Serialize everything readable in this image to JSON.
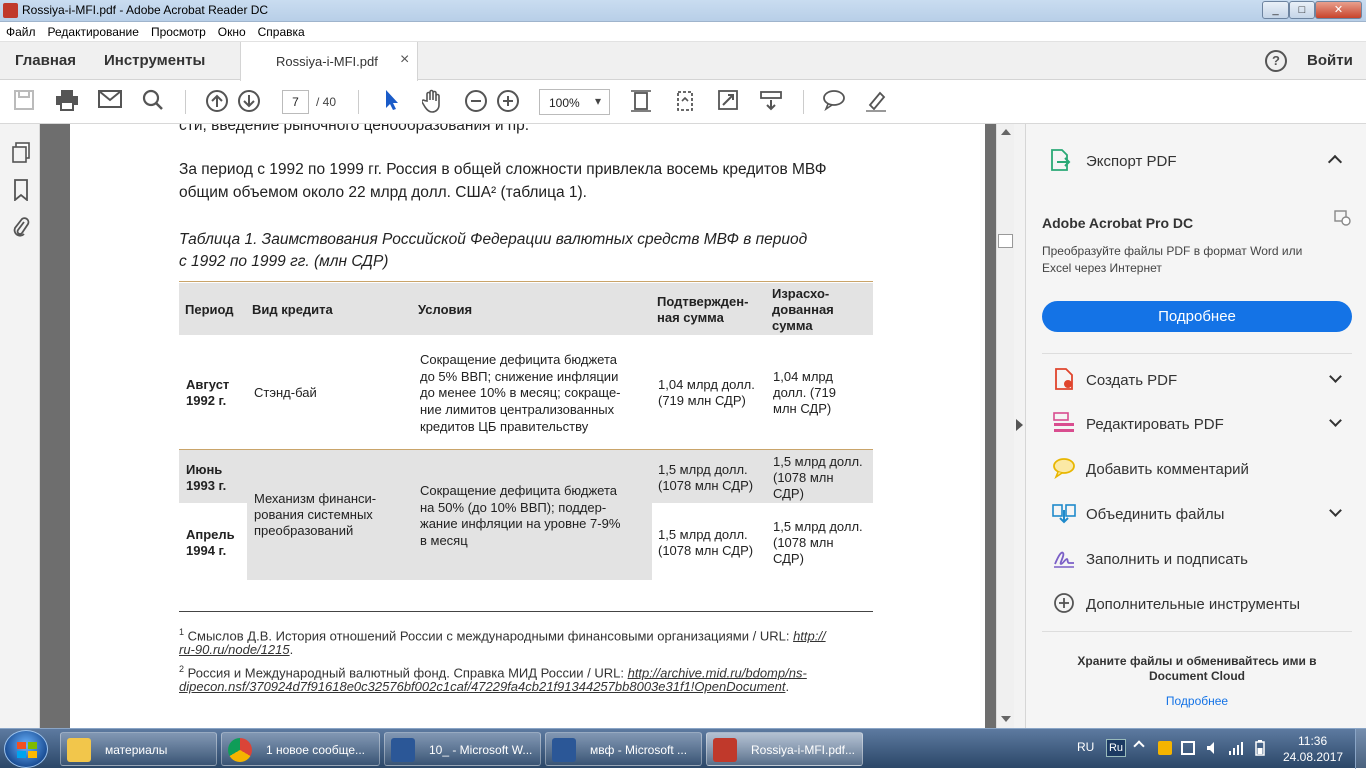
{
  "window": {
    "title": "Rossiya-i-MFI.pdf - Adobe Acrobat Reader DC",
    "min": "_",
    "max": "□",
    "close": "✕"
  },
  "menu": [
    "Файл",
    "Редактирование",
    "Просмотр",
    "Окно",
    "Справка"
  ],
  "tabs": {
    "home": "Главная",
    "tools": "Инструменты",
    "doc": "Rossiya-i-MFI.pdf",
    "doc_close": "×",
    "help": "?",
    "signin": "Войти"
  },
  "toolbar": {
    "page_current": "7",
    "page_total": "/ 40",
    "zoom": "100%",
    "zoom_arrow": "▾"
  },
  "document": {
    "cut_line": "сти, введение рыночного ценообразования и пр.",
    "para1_line1": "За период с 1992 по 1999 гг. Россия в общей сложности привлекла восемь кредитов МВФ",
    "para1_line2": "общим объемом около 22 млрд долл. США² (таблица 1).",
    "caption_line1": "Таблица 1. Заимствования Российской Федерации валютных средств МВФ в период",
    "caption_line2": "с 1992 по 1999 гг. (млн СДР)",
    "table": {
      "headers": [
        "Период",
        "Вид кредита",
        "Условия",
        "Подтвержден-\nная сумма",
        "Израсхо-\nдованная\nсумма"
      ],
      "row1": {
        "period": "Август\n1992 г.",
        "type": "Стэнд-бай",
        "conditions": "Сокращение дефицита бюджета\nдо 5% ВВП; снижение инфляции\nдо менее 10% в месяц; сокраще-\nние лимитов централизованных\nкредитов ЦБ правительству",
        "confirmed": "1,04 млрд долл.\n(719 млн СДР)",
        "spent": "1,04 млрд\nдолл. (719\nмлн СДР)"
      },
      "row2": {
        "period": "Июнь\n1993 г.",
        "confirmed": "1,5 млрд долл.\n(1078 млн СДР)",
        "spent": "1,5 млрд долл.\n(1078 млн\nСДР)"
      },
      "row3": {
        "period": "Апрель\n1994 г.",
        "confirmed": "1,5 млрд долл.\n(1078 млн СДР)",
        "spent": "1,5 млрд долл.\n(1078 млн\nСДР)"
      },
      "shared_type": "Механизм финанси-\nрования системных\nпреобразований",
      "shared_conditions": "Сокращение дефицита бюджета\nна 50% (до 10% ВВП); поддер-\nжание инфляции на уровне 7-9%\nв месяц"
    },
    "fn1_sup": "1",
    "fn1_text": "Смыслов Д.В. История отношений России с международными финансовыми организациями / URL: ",
    "fn1_link_a": "http://",
    "fn1_link_b": "ru-90.ru/node/1215",
    "fn1_end": ".",
    "fn2_sup": "2",
    "fn2_text": "Россия и Международный валютный фонд. Справка МИД России / URL: ",
    "fn2_link_a": "http://archive.mid.ru/bdomp/ns-",
    "fn2_link_b": "dipecon.nsf/370924d7f91618e0c32576bf002c1caf/47229fa4cb21f91344257bb8003e31f1!OpenDocument",
    "fn2_end": "."
  },
  "right_panel": {
    "export": "Экспорт PDF",
    "product": "Adobe Acrobat Pro DC",
    "product_desc_1": "Преобразуйте файлы PDF в формат Word или",
    "product_desc_2": "Excel через Интернет",
    "more_button": "Подробнее",
    "items": [
      {
        "label": "Создать PDF",
        "icon": "create-pdf-icon"
      },
      {
        "label": "Редактировать PDF",
        "icon": "edit-pdf-icon"
      },
      {
        "label": "Добавить комментарий",
        "icon": "comment-icon"
      },
      {
        "label": "Объединить файлы",
        "icon": "combine-files-icon"
      },
      {
        "label": "Заполнить и подписать",
        "icon": "fill-sign-icon"
      },
      {
        "label": "Дополнительные инструменты",
        "icon": "more-tools-icon"
      }
    ],
    "cloud_1": "Храните файлы и обменивайтесь ими в",
    "cloud_2": "Document Cloud",
    "cloud_link": "Подробнее"
  },
  "taskbar": {
    "items": [
      "материалы",
      "1 новое сообще...",
      "10_ - Microsoft W...",
      "мвф - Microsoft ...",
      "Rossiya-i-MFI.pdf..."
    ],
    "lang": "RU",
    "kb": "Ru",
    "time": "11:36",
    "date": "24.08.2017"
  },
  "colors": {
    "accent": "#1473e6",
    "table_header": "#e3e3e3",
    "row_shade": "#e3e3e3",
    "rule": "#c9a46a"
  }
}
